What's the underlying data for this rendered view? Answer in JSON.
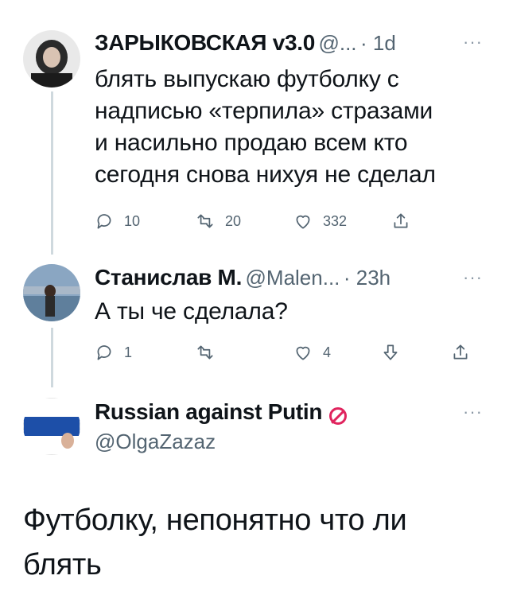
{
  "tweets": [
    {
      "name": "ЗАРЫКОВСКАЯ v3.0",
      "handle": "@...",
      "time": "· 1d",
      "more": "···",
      "lines": [
        "блять выпускаю футболку с",
        "надписью «терпила» стразами",
        "и насильно продаю всем кто",
        "сегодня снова нихуя не сделал"
      ],
      "actions": {
        "reply": "10",
        "retweet": "20",
        "like": "332"
      }
    },
    {
      "name": "Станислав М.",
      "handle": "@Malen...",
      "time": "· 23h",
      "more": "···",
      "lines": [
        "А ты че сделала?"
      ],
      "actions": {
        "reply": "1",
        "like": "4"
      }
    },
    {
      "name": "Russian against Putin",
      "handle": "@OlgaZazaz",
      "more": "···",
      "lines": [
        "Футболку, непонятно что ли",
        "блять"
      ]
    }
  ],
  "colors": {
    "text": "#0f1419",
    "meta": "#536471",
    "line": "#cfd9de",
    "ban": "#e0245e"
  }
}
